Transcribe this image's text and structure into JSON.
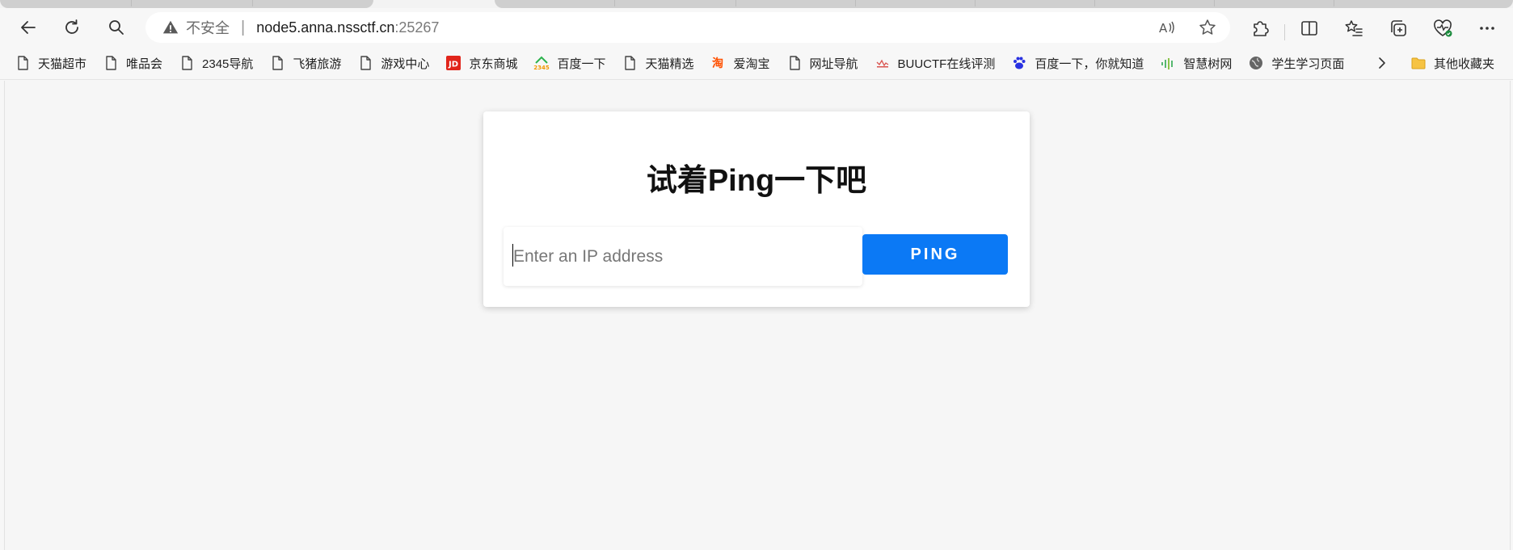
{
  "browser": {
    "address": {
      "security_label": "不安全",
      "separator": "|",
      "host": "node5.anna.nssctf.cn",
      "port": ":25267"
    },
    "bookmarks": [
      {
        "label": "天猫超市",
        "icon": "page-icon"
      },
      {
        "label": "唯品会",
        "icon": "page-icon"
      },
      {
        "label": "2345导航",
        "icon": "page-icon"
      },
      {
        "label": "飞猪旅游",
        "icon": "page-icon"
      },
      {
        "label": "游戏中心",
        "icon": "page-icon"
      },
      {
        "label": "京东商城",
        "icon": "jd-logo-icon"
      },
      {
        "label": "百度一下",
        "icon": "2345-logo-icon"
      },
      {
        "label": "天猫精选",
        "icon": "page-icon"
      },
      {
        "label": "爱淘宝",
        "icon": "taobao-logo-icon"
      },
      {
        "label": "网址导航",
        "icon": "page-icon"
      },
      {
        "label": "BUUCTF在线评测",
        "icon": "buuctf-logo-icon"
      },
      {
        "label": "百度一下，你就知道",
        "icon": "baidu-paw-icon"
      },
      {
        "label": "智慧树网",
        "icon": "zhihuishu-logo-icon"
      },
      {
        "label": "学生学习页面",
        "icon": "globe-icon"
      }
    ],
    "other_bookmarks": "其他收藏夹"
  },
  "page": {
    "heading": "试着Ping一下吧",
    "ip_placeholder": "Enter an IP address",
    "ping_label": "PING"
  },
  "colors": {
    "ping_button": "#0b79f5",
    "page_background": "#f6f6f6",
    "card_background": "#ffffff"
  }
}
